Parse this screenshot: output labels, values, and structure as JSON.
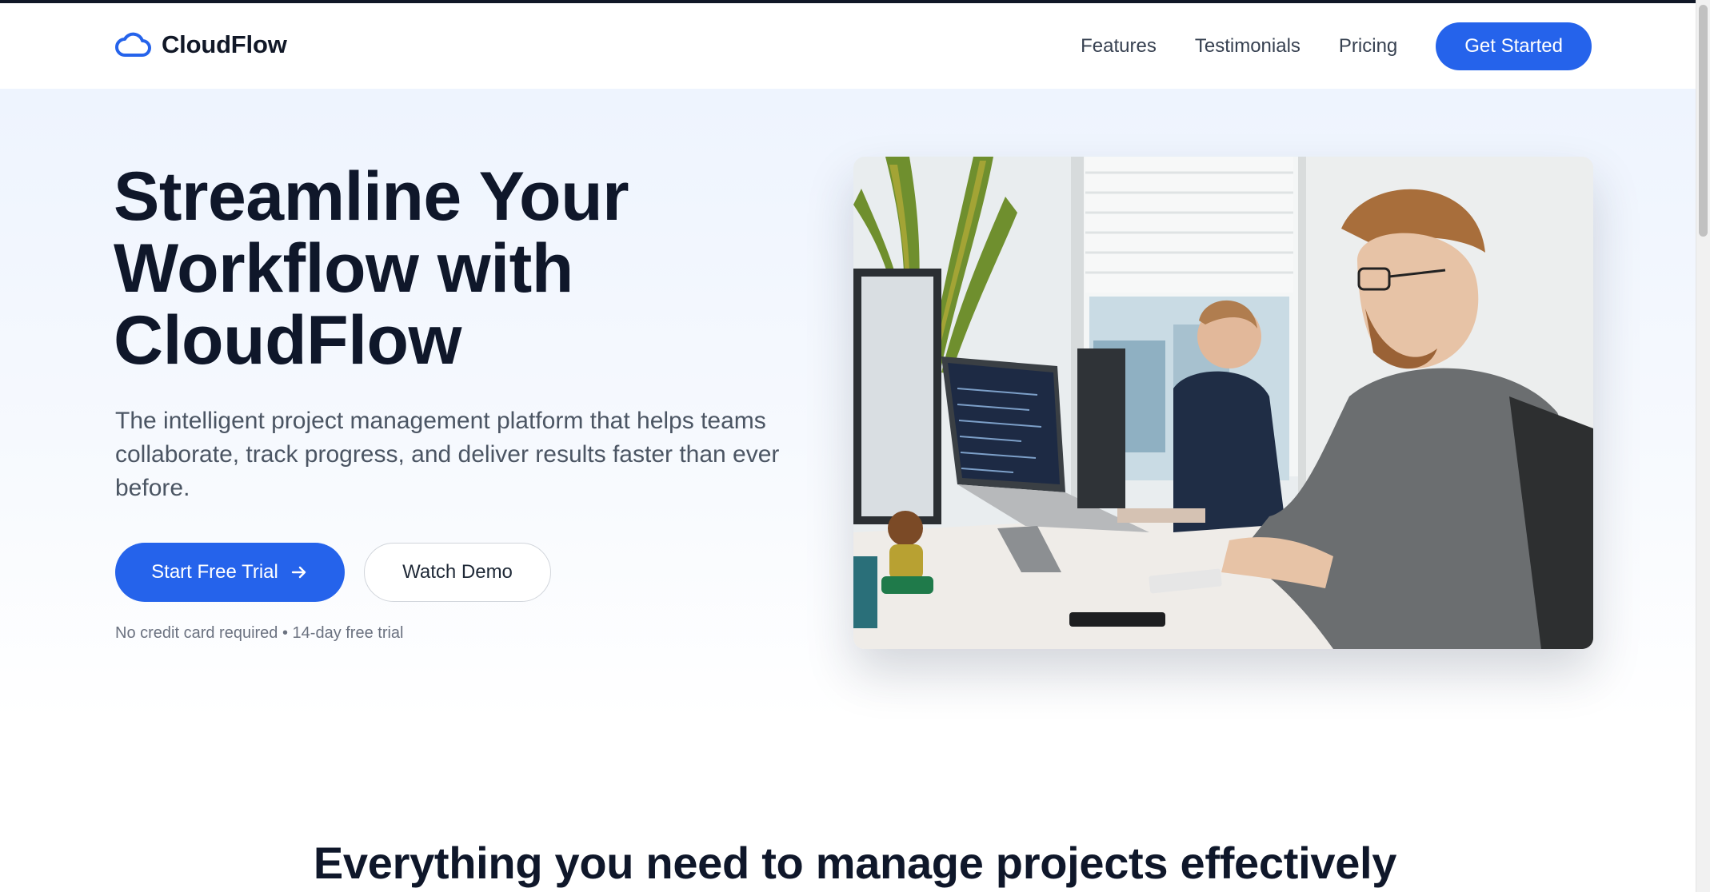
{
  "brand": {
    "name": "CloudFlow",
    "icon": "cloud-icon",
    "accent_color": "#2563eb"
  },
  "nav": {
    "links": [
      {
        "label": "Features"
      },
      {
        "label": "Testimonials"
      },
      {
        "label": "Pricing"
      }
    ],
    "cta_label": "Get Started"
  },
  "hero": {
    "title_line1": "Streamline Your",
    "title_line2": "Workflow with",
    "title_line3": "CloudFlow",
    "subtitle": "The intelligent project management platform that helps teams collaborate, track progress, and deliver results faster than ever before.",
    "primary_label": "Start Free Trial",
    "primary_icon": "arrow-right-icon",
    "secondary_label": "Watch Demo",
    "note": "No credit card required • 14-day free trial"
  },
  "features": {
    "title": "Everything you need to manage projects effectively"
  }
}
